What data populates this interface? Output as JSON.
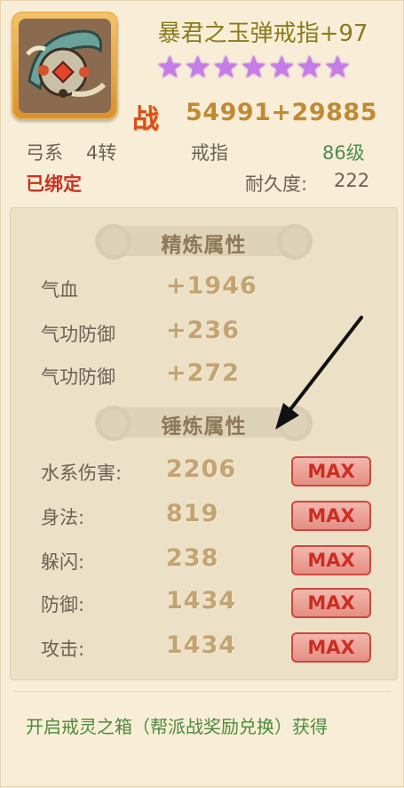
{
  "item": {
    "name": "暴君之玉弹戒指+97",
    "star_count": 7,
    "power_prefix": "战",
    "power": "54991+29885",
    "class": "弓系",
    "rebirth": "4转",
    "slot": "戒指",
    "level": "86级",
    "bound": "已绑定",
    "durability_label": "耐久度:",
    "durability_value": "222"
  },
  "refine": {
    "title": "精炼属性",
    "attrs": [
      {
        "name": "气血",
        "value": "+1946"
      },
      {
        "name": "气功防御",
        "value": "+236"
      },
      {
        "name": "气功防御",
        "value": "+272"
      }
    ]
  },
  "forge": {
    "title": "锤炼属性",
    "attrs": [
      {
        "name": "水系伤害:",
        "value": "2206",
        "max": "MAX"
      },
      {
        "name": "身法:",
        "value": "819",
        "max": "MAX"
      },
      {
        "name": "躲闪:",
        "value": "238",
        "max": "MAX"
      },
      {
        "name": "防御:",
        "value": "1434",
        "max": "MAX"
      },
      {
        "name": "攻击:",
        "value": "1434",
        "max": "MAX"
      }
    ]
  },
  "source": "开启戒灵之箱（帮派战奖励兑换）获得",
  "colors": {
    "name": "#8a7a1e",
    "power": "#c08a35",
    "bound": "#c83223",
    "level": "#4f8a52",
    "max_border": "#cc4a3c",
    "source": "#4d8a3a"
  },
  "icons": [
    "ring-item-icon",
    "star-icon",
    "swirl-ornament-icon",
    "annotation-arrow-icon"
  ]
}
